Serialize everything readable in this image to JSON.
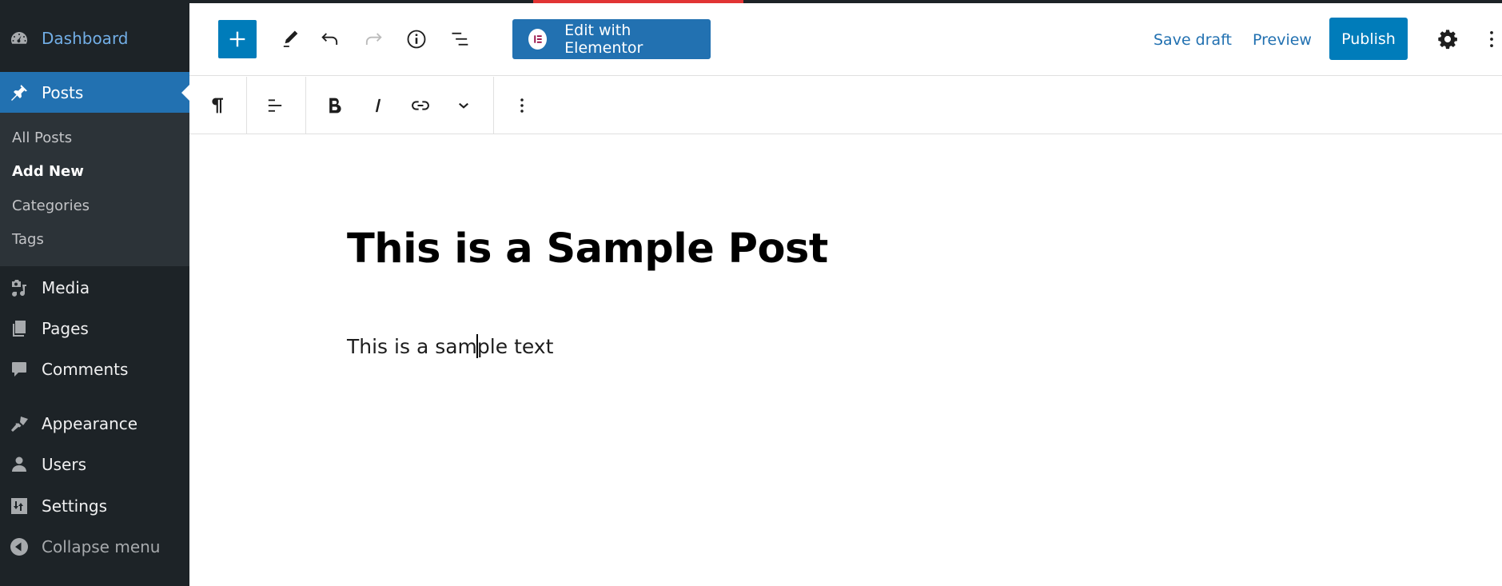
{
  "sidebar": {
    "menu": [
      {
        "label": "Dashboard",
        "icon": "dashboard-icon"
      },
      {
        "label": "Posts",
        "icon": "pin-icon",
        "active": true
      },
      {
        "label": "Media",
        "icon": "media-icon"
      },
      {
        "label": "Pages",
        "icon": "pages-icon"
      },
      {
        "label": "Comments",
        "icon": "comments-icon"
      },
      {
        "label": "Appearance",
        "icon": "appearance-icon"
      },
      {
        "label": "Users",
        "icon": "users-icon"
      },
      {
        "label": "Settings",
        "icon": "settings-icon"
      }
    ],
    "submenu": [
      {
        "label": "All Posts"
      },
      {
        "label": "Add New",
        "current": true
      },
      {
        "label": "Categories"
      },
      {
        "label": "Tags"
      }
    ],
    "collapse_label": "Collapse menu"
  },
  "toolbar": {
    "inserter_icon": "plus-icon",
    "tools_icon": "pencil-icon",
    "undo_icon": "undo-icon",
    "redo_icon": "redo-icon",
    "details_icon": "info-icon",
    "list_view_icon": "list-view-icon",
    "elementor_label": "Edit with Elementor",
    "save_draft_label": "Save draft",
    "preview_label": "Preview",
    "publish_label": "Publish",
    "settings_icon": "gear-icon",
    "options_icon": "kebab-icon"
  },
  "block_toolbar": {
    "buttons": [
      "paragraph-icon",
      "align-icon",
      "bold-icon",
      "italic-icon",
      "link-icon",
      "chevron-down-icon",
      "kebab-icon"
    ]
  },
  "post": {
    "title": "This is a Sample Post",
    "body_before_caret": "This is a sam",
    "body_after_caret": "ple text"
  },
  "colors": {
    "sidebar_bg": "#1d2327",
    "submenu_bg": "#2c3338",
    "active_bg": "#2271b1",
    "primary_button": "#007cba",
    "accent_bar": "#e13434"
  }
}
